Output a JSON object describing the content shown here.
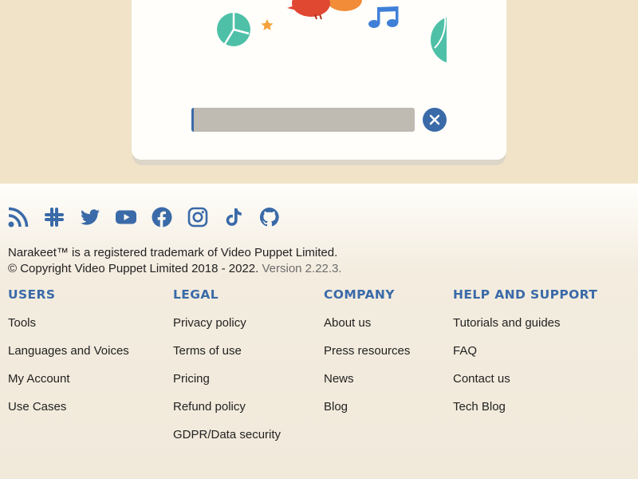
{
  "progress": {
    "fraction": 0.012
  },
  "colors": {
    "accent": "#3a6aa8",
    "illustration_green": "#4fc0a8",
    "illustration_orange": "#f28c38",
    "illustration_red": "#e04832",
    "illustration_blue": "#3f7fd8"
  },
  "social": [
    {
      "name": "rss-icon"
    },
    {
      "name": "slack-icon"
    },
    {
      "name": "twitter-icon"
    },
    {
      "name": "youtube-icon"
    },
    {
      "name": "facebook-icon"
    },
    {
      "name": "instagram-icon"
    },
    {
      "name": "tiktok-icon"
    },
    {
      "name": "github-icon"
    }
  ],
  "legal": {
    "trademark": "Narakeet™ is a registered trademark of Video Puppet Limited.",
    "copyright": "© Copyright Video Puppet Limited 2018 - 2022.",
    "version": "Version 2.22.3."
  },
  "footer": {
    "users": {
      "title": "USERS",
      "links": [
        "Tools",
        "Languages and Voices",
        "My Account",
        "Use Cases"
      ]
    },
    "legal": {
      "title": "LEGAL",
      "links": [
        "Privacy policy",
        "Terms of use",
        "Pricing",
        "Refund policy",
        "GDPR/Data security"
      ]
    },
    "company": {
      "title": "COMPANY",
      "links": [
        "About us",
        "Press resources",
        "News",
        "Blog"
      ]
    },
    "help": {
      "title": "HELP AND SUPPORT",
      "links": [
        "Tutorials and guides",
        "FAQ",
        "Contact us",
        "Tech Blog"
      ]
    }
  }
}
